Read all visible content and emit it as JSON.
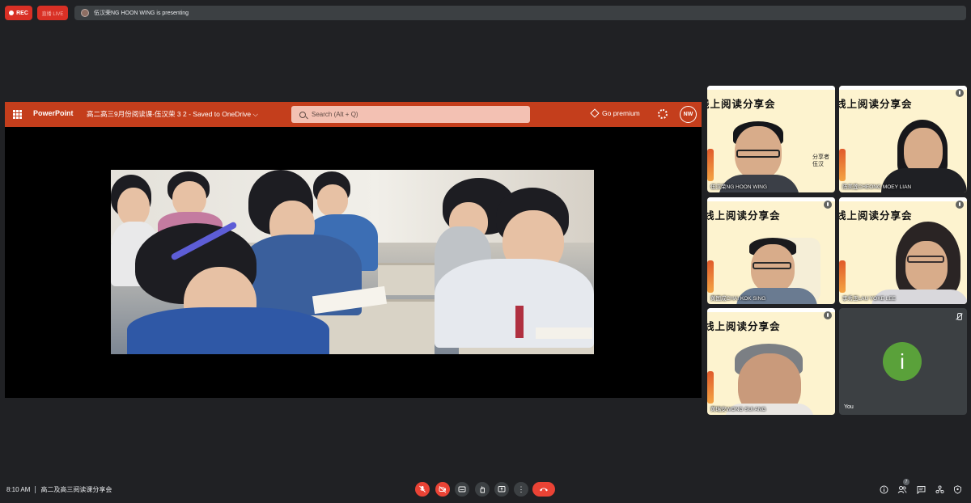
{
  "topbar": {
    "rec_label": "REC",
    "live_label": "直播 LIVE",
    "presenting_text": "伍汉荣NG HOON WING is presenting"
  },
  "powerpoint": {
    "app_name": "PowerPoint",
    "doc_title": "高二高三9月份阅读课-伍汉荣 3 2  -  Saved to OneDrive ⌵",
    "search_placeholder": "Search (Alt + Q)",
    "premium_label": "Go premium",
    "user_initials": "NW"
  },
  "participants": [
    {
      "banner": "线上阅读分享会",
      "name": "伍汉荣NG HOON WING",
      "extra": "分享者 伍汉"
    },
    {
      "banner": "线上阅读分享会",
      "name": "陈美莲CHEONG MOEY LIAN"
    },
    {
      "banner": "线上阅读分享会",
      "name": "黄国成CHAI KOK SING"
    },
    {
      "banner": "线上阅读分享会",
      "name": "李秀玉LAU YOKE LEE"
    },
    {
      "banner": "线上阅读分享会",
      "name": "黄瑞安WONG SUI ANG"
    },
    {
      "avatar_letter": "i",
      "name": "You"
    }
  ],
  "bottombar": {
    "time": "8:10 AM",
    "meeting_title": "高二及高三阅读课分享会",
    "people_count": "7"
  },
  "colors": {
    "background": "#202124",
    "ppt_accent": "#c43e1c",
    "danger": "#ea4335",
    "you_avatar": "#5aa13a"
  },
  "icons": [
    "rec-dot-icon",
    "app-launcher-icon",
    "search-icon",
    "diamond-icon",
    "gear-icon",
    "mic-off-icon",
    "camera-off-icon",
    "captions-icon",
    "raise-hand-icon",
    "present-icon",
    "more-options-icon",
    "end-call-icon",
    "info-icon",
    "people-icon",
    "chat-icon",
    "activities-icon",
    "host-controls-icon"
  ]
}
